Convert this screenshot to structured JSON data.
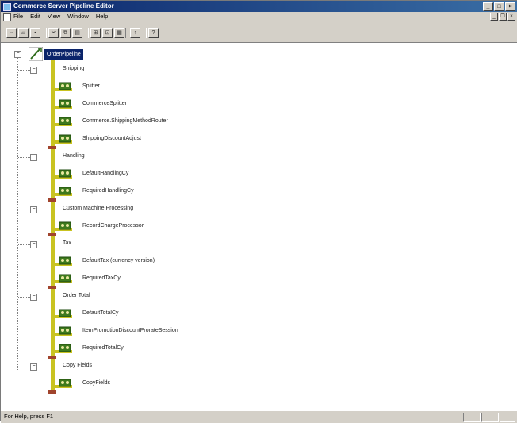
{
  "window": {
    "title": "Commerce Server Pipeline Editor",
    "buttons": {
      "minimize": "_",
      "maximize": "□",
      "close": "×"
    }
  },
  "menu": {
    "items": [
      "File",
      "Edit",
      "View",
      "Window",
      "Help"
    ],
    "mdi_buttons": {
      "minimize": "_",
      "restore": "❐",
      "close": "×"
    }
  },
  "toolbar": {
    "buttons": [
      {
        "name": "new-button",
        "glyph": "▫"
      },
      {
        "name": "open-button",
        "glyph": "▱"
      },
      {
        "name": "save-button",
        "glyph": "▪"
      },
      {
        "name": "cut-button",
        "glyph": "✂"
      },
      {
        "name": "copy-button",
        "glyph": "⧉"
      },
      {
        "name": "paste-button",
        "glyph": "▤"
      },
      {
        "name": "insert-stage-button",
        "glyph": "⊞"
      },
      {
        "name": "insert-component-button",
        "glyph": "⊡"
      },
      {
        "name": "properties-button",
        "glyph": "▦"
      },
      {
        "name": "move-up-button",
        "glyph": "↑"
      },
      {
        "name": "help-button",
        "glyph": "?"
      }
    ]
  },
  "tree": {
    "pipeline_name": "OrderPipeline",
    "expand_glyph": "−",
    "stages": [
      {
        "name": "Shipping",
        "components": [
          "Splitter",
          "CommerceSplitter",
          "Commerce.ShippingMethodRouter",
          "ShippingDiscountAdjust"
        ]
      },
      {
        "name": "Handling",
        "components": [
          "DefaultHandlingCy",
          "RequiredHandlingCy"
        ]
      },
      {
        "name": "Custom Machine Processing",
        "components": [
          "RecordChargeProcessor"
        ]
      },
      {
        "name": "Tax",
        "components": [
          "DefaultTax (currency version)",
          "RequiredTaxCy"
        ]
      },
      {
        "name": "Order Total",
        "components": [
          "DefaultTotalCy",
          "ItemPromotionDiscountProrateSession",
          "RequiredTotalCy"
        ]
      },
      {
        "name": "Copy Fields",
        "components": [
          "CopyFields"
        ]
      }
    ]
  },
  "status": {
    "text": "For Help, press F1"
  },
  "colors": {
    "stem": "#c9c321",
    "stage_end": "#a0442d",
    "selection": "#0a246a",
    "component_green": "#3e7a1d"
  }
}
